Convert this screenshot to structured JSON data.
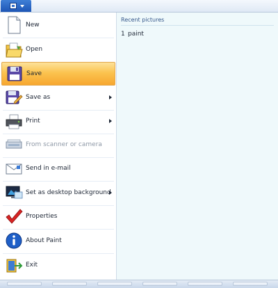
{
  "menu": {
    "items": [
      {
        "label": "New",
        "icon": "new-document-icon"
      },
      {
        "label": "Open",
        "icon": "open-folder-icon"
      },
      {
        "label": "Save",
        "icon": "save-disk-icon",
        "selected": true
      },
      {
        "label": "Save as",
        "icon": "save-as-icon",
        "submenu": true
      },
      {
        "label": "Print",
        "icon": "printer-icon",
        "submenu": true
      },
      {
        "label": "From scanner or camera",
        "icon": "scanner-icon",
        "disabled": true
      },
      {
        "label": "Send in e-mail",
        "icon": "email-icon"
      },
      {
        "label": "Set as desktop background",
        "icon": "desktop-background-icon",
        "submenu": true
      },
      {
        "label": "Properties",
        "icon": "checkmark-icon"
      },
      {
        "label": "About Paint",
        "icon": "info-icon"
      },
      {
        "label": "Exit",
        "icon": "exit-icon"
      }
    ]
  },
  "recent": {
    "title": "Recent pictures",
    "items": [
      {
        "number": "1",
        "name": "paint"
      }
    ]
  },
  "colors": {
    "selected_top": "#fde29a",
    "selected_bottom": "#f7a730",
    "recent_bg": "#eff9fb",
    "accent_blue": "#1d55b5"
  }
}
